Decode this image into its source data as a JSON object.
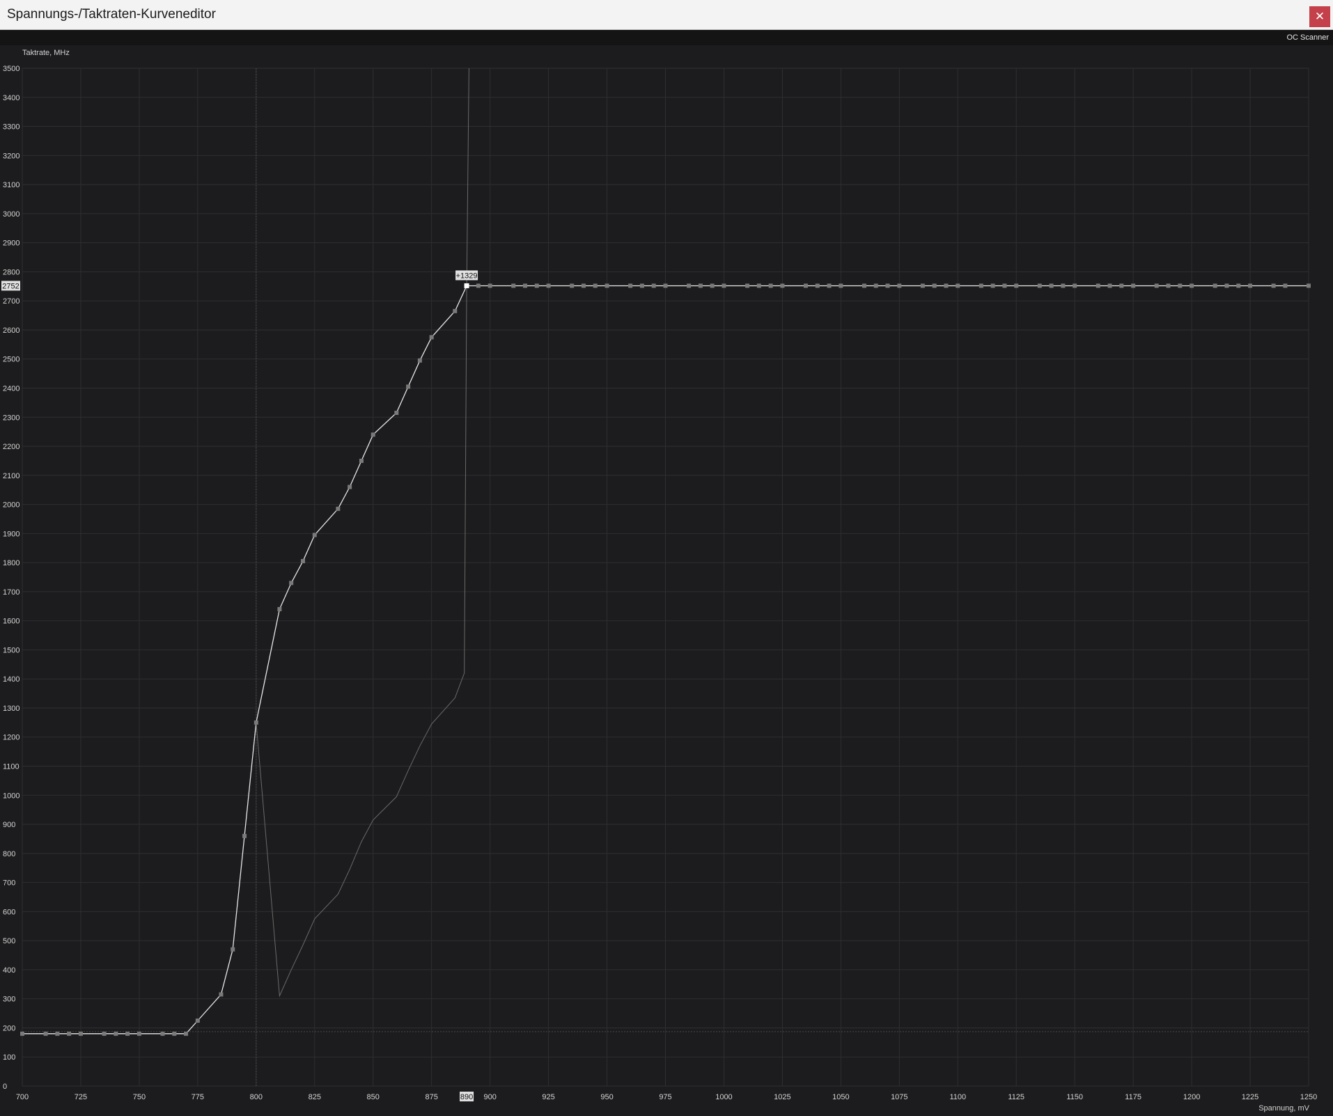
{
  "window": {
    "title": "Spannungs-/Taktraten-Kurveneditor",
    "close_label": "✕",
    "close_icon": "close-icon"
  },
  "toolbar": {
    "oc_scanner_label": "OC Scanner"
  },
  "colors": {
    "background": "#1c1c1e",
    "grid": "#2f2f33",
    "curve": "#e8e8e8",
    "reference_curve": "#6a6a6a",
    "point": "#7a7a7a",
    "close_button": "#c4404a"
  },
  "chart_data": {
    "type": "line",
    "xlabel": "Spannung, mV",
    "ylabel": "Taktrate, MHz",
    "xlim": [
      700,
      1250
    ],
    "ylim": [
      0,
      3500
    ],
    "xticks": [
      700,
      725,
      750,
      775,
      800,
      825,
      850,
      875,
      900,
      925,
      950,
      975,
      1000,
      1025,
      1050,
      1075,
      1100,
      1125,
      1150,
      1175,
      1200,
      1225,
      1250
    ],
    "yticks": [
      0,
      100,
      200,
      300,
      400,
      500,
      600,
      700,
      800,
      900,
      1000,
      1100,
      1200,
      1300,
      1400,
      1500,
      1600,
      1700,
      1800,
      1900,
      2000,
      2100,
      2200,
      2300,
      2400,
      2500,
      2600,
      2700,
      2800,
      2900,
      3000,
      3100,
      3200,
      3300,
      3400,
      3500
    ],
    "grid": true,
    "cursor": {
      "voltage": 800,
      "baseline_clock": 187
    },
    "selected_point": {
      "x": 890,
      "y": 2752,
      "x_label": "890",
      "y_label": "2752",
      "offset_label": "+1329"
    },
    "series": [
      {
        "kind": "edited_curve",
        "x": [
          700,
          710,
          715,
          720,
          725,
          735,
          740,
          745,
          750,
          760,
          765,
          770,
          775,
          785,
          790,
          795,
          800,
          810,
          815,
          820,
          825,
          835,
          840,
          845,
          850,
          860,
          865,
          870,
          875,
          885,
          890,
          895,
          900,
          910,
          915,
          920,
          925,
          935,
          940,
          945,
          950,
          960,
          965,
          970,
          975,
          985,
          990,
          995,
          1000,
          1010,
          1015,
          1020,
          1025,
          1035,
          1040,
          1045,
          1050,
          1060,
          1065,
          1070,
          1075,
          1085,
          1090,
          1095,
          1100,
          1110,
          1115,
          1120,
          1125,
          1135,
          1140,
          1145,
          1150,
          1160,
          1165,
          1170,
          1175,
          1185,
          1190,
          1195,
          1200,
          1210,
          1215,
          1220,
          1225,
          1235,
          1240,
          1250
        ],
        "y": [
          180,
          180,
          180,
          180,
          180,
          180,
          180,
          180,
          180,
          180,
          180,
          180,
          225,
          315,
          470,
          860,
          1250,
          1640,
          1730,
          1805,
          1895,
          1985,
          2060,
          2150,
          2240,
          2315,
          2405,
          2495,
          2575,
          2665,
          2752,
          2752,
          2752,
          2752,
          2752,
          2752,
          2752,
          2752,
          2752,
          2752,
          2752,
          2752,
          2752,
          2752,
          2752,
          2752,
          2752,
          2752,
          2752,
          2752,
          2752,
          2752,
          2752,
          2752,
          2752,
          2752,
          2752,
          2752,
          2752,
          2752,
          2752,
          2752,
          2752,
          2752,
          2752,
          2752,
          2752,
          2752,
          2752,
          2752,
          2752,
          2752,
          2752,
          2752,
          2752,
          2752,
          2752,
          2752,
          2752,
          2752,
          2752,
          2752,
          2752,
          2752,
          2752,
          2752,
          2752,
          2752
        ]
      },
      {
        "kind": "base_curve",
        "x": [
          800,
          810,
          815,
          820,
          825,
          835,
          840,
          845,
          850,
          860,
          865,
          870,
          875,
          885,
          889,
          890,
          891
        ],
        "y": [
          1250,
          310,
          400,
          485,
          575,
          660,
          745,
          840,
          915,
          995,
          1085,
          1170,
          1245,
          1335,
          1420,
          2752,
          3500
        ]
      }
    ]
  }
}
